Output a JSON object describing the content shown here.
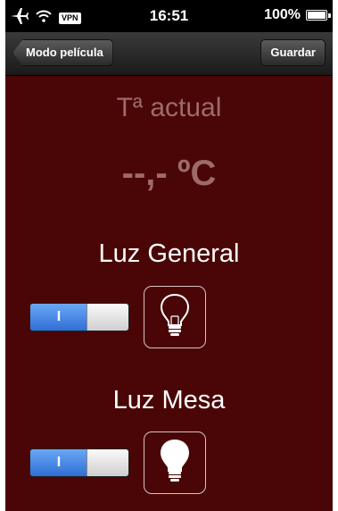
{
  "status_bar": {
    "vpn": "VPN",
    "time": "16:51",
    "battery": "100%",
    "icons": [
      "airplane-icon",
      "wifi-icon",
      "battery-icon"
    ]
  },
  "nav": {
    "back_label": "Modo película",
    "save_label": "Guardar"
  },
  "temperature": {
    "label": "Tª actual",
    "value": "--,- ºC"
  },
  "lights": [
    {
      "title": "Luz General",
      "switch_label": "I",
      "on": true,
      "bulb": "bulb-off-icon"
    },
    {
      "title": "Luz Mesa",
      "switch_label": "I",
      "on": true,
      "bulb": "bulb-on-icon"
    }
  ],
  "colors": {
    "background": "#4a0606",
    "switch_on": "#2f6fd6",
    "muted_text": "#9e6b6b"
  }
}
